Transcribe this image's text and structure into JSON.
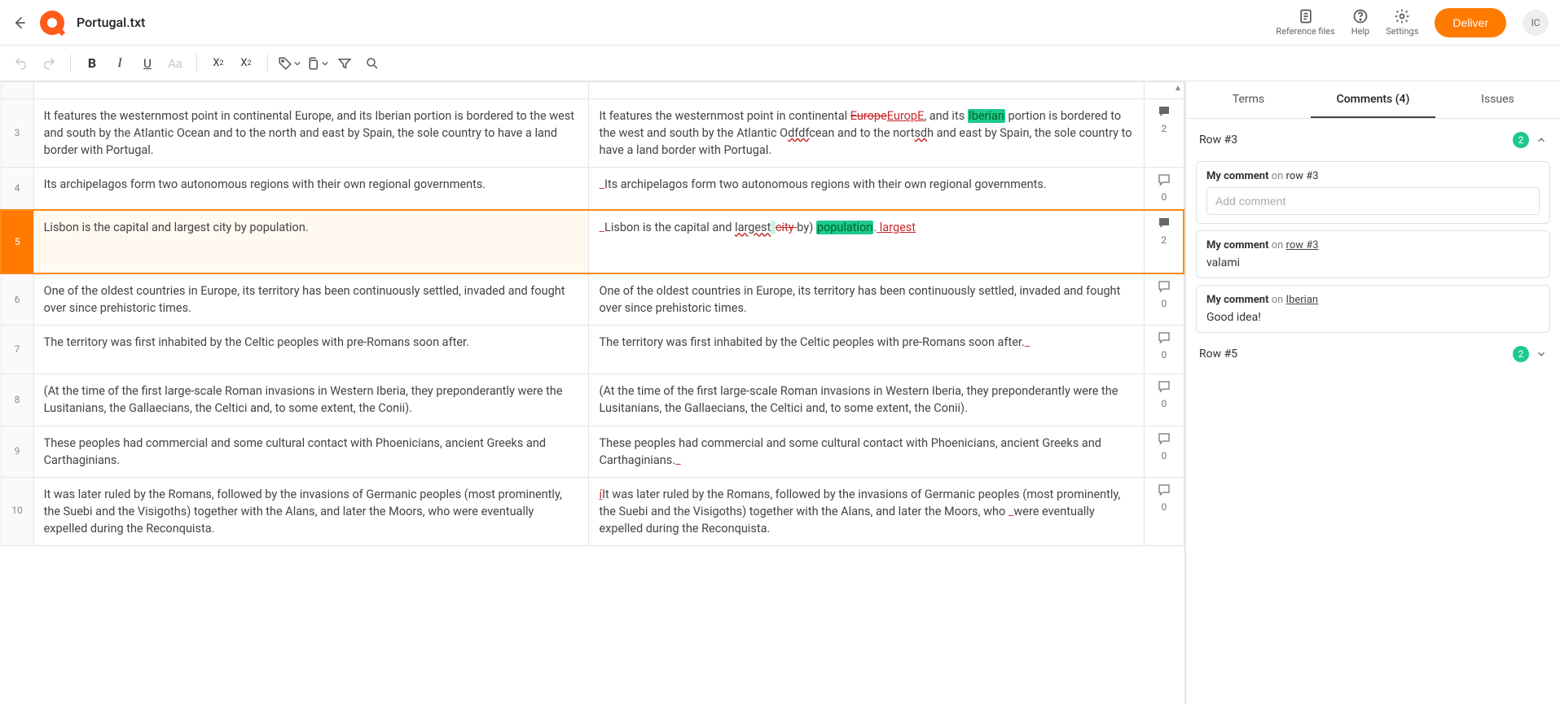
{
  "header": {
    "file_title": "Portugal.txt",
    "actions": {
      "reference": "Reference files",
      "help": "Help",
      "settings": "Settings"
    },
    "deliver_label": "Deliver",
    "avatar_initials": "IC"
  },
  "side_tabs": {
    "terms": "Terms",
    "comments": "Comments (4)",
    "issues": "Issues"
  },
  "comment_panel": {
    "row3": {
      "title": "Row #3",
      "badge": "2",
      "new_comment_head_a": "My comment",
      "new_comment_head_b": " on ",
      "new_comment_head_c": "row #3",
      "input_placeholder": "Add comment",
      "c1_head_a": "My comment",
      "c1_head_b": " on ",
      "c1_link": "row #3",
      "c1_body": "valami",
      "c2_head_a": "My comment",
      "c2_head_b": " on ",
      "c2_link": "Iberian",
      "c2_body": "Good idea!"
    },
    "row5": {
      "title": "Row #5",
      "badge": "2"
    }
  },
  "rows": [
    {
      "num": "3",
      "source": "It features the westernmost point in continental Europe, and its Iberian portion is bordered to the west and south by the Atlantic Ocean and to the north and east by Spain, the sole country to have a land border with Portugal.",
      "comments": "2",
      "comment_filled": true
    },
    {
      "num": "4",
      "source": "Its archipelagos form two autonomous regions with their own regional governments.",
      "target_plain": "Its archipelagos form two autonomous regions with their own regional governments.",
      "comments": "0"
    },
    {
      "num": "5",
      "source": "Lisbon is the capital and largest city by population.",
      "comments": "2",
      "comment_filled": true,
      "active": true
    },
    {
      "num": "6",
      "source": "One of the oldest countries in Europe, its territory has been continuously settled, invaded and fought over since prehistoric times.",
      "target_plain": "One of the oldest countries in Europe, its territory has been continuously settled, invaded and fought over since prehistoric times.",
      "comments": "0"
    },
    {
      "num": "7",
      "source": "The territory was first inhabited by the Celtic peoples with pre-Romans soon after.",
      "comments": "0"
    },
    {
      "num": "8",
      "source": "(At the time of the first large-scale Roman invasions in Western Iberia, they preponderantly were the Lusitanians, the Gallaecians, the Celtici and, to some extent, the Conii).",
      "target_plain": "(At the time of the first large-scale Roman invasions in Western Iberia, they preponderantly were the Lusitanians, the Gallaecians, the Celtici and, to some extent, the Conii).",
      "comments": "0"
    },
    {
      "num": "9",
      "source": "These peoples had commercial and some cultural contact with Phoenicians, ancient Greeks and Carthaginians.",
      "comments": "0"
    },
    {
      "num": "10",
      "source": "It was later ruled by the Romans, followed by the invasions of Germanic peoples (most prominently, the Suebi and the Visigoths) together with the Alans, and later the Moors, who were eventually expelled during the Reconquista.",
      "comments": "0"
    }
  ],
  "target_frag": {
    "r3_a": "It features the westernmost point in continental ",
    "r3_strike": "Europe",
    "r3_ins": "EuropE",
    "r3_b": ", and its ",
    "r3_hl": "Iberian",
    "r3_c": " portion is bordered to the west and south by the Atlantic O",
    "r3_wavy": "dfdf",
    "r3_d": "cean and to the nort",
    "r3_wavy2": "sd",
    "r3_e": "h and east by Spain, the sole country to have a land border with Portugal.",
    "r5_a": "Lisbon is the capital and ",
    "r5_wavy": "largest",
    "r5_sp": " ",
    "r5_strike": " city ",
    "r5_b": "by) ",
    "r5_hl": "population",
    "r5_dot": ".",
    "r5_ins": " largest",
    "r7_a": "The territory was first inhabited by the Celtic peoples with pre-Romans soon after.",
    "r9_a": "These peoples had commercial and some cultural contact with Phoenicians, ancient Greeks and Carthaginians.",
    "r10_ins": "í",
    "r10_a": "It was later ruled by the Romans, followed by the invasions of Germanic peoples (most prominently, the Suebi and the Visigoths) together with the Alans, and later the Moors, who ",
    "r10_sp": " ",
    "r10_b": "were eventually expelled during the Reconquista."
  }
}
